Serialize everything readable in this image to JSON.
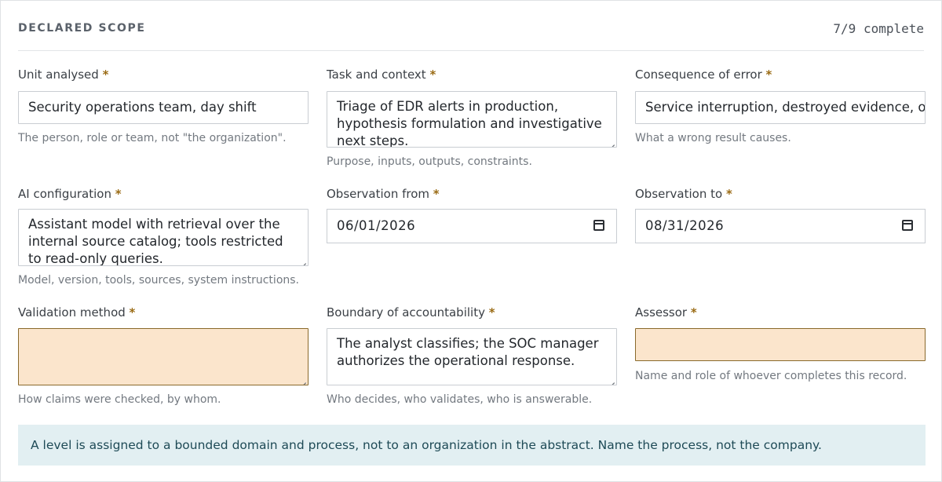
{
  "section": {
    "title": "DECLARED SCOPE",
    "progress": "7/9 complete"
  },
  "required_mark": "*",
  "fields": {
    "unit": {
      "label": "Unit analysed",
      "value": "Security operations team, day shift",
      "hint": "The person, role or team, not \"the organization\"."
    },
    "task": {
      "label": "Task and context",
      "value": "Triage of EDR alerts in production, hypothesis formulation and investigative next steps.",
      "hint": "Purpose, inputs, outputs, constraints."
    },
    "consequence": {
      "label": "Consequence of error",
      "value": "Service interruption, destroyed evidence, or a",
      "hint": "What a wrong result causes."
    },
    "ai_config": {
      "label": "AI configuration",
      "value": "Assistant model with retrieval over the internal source catalog; tools restricted to read-only queries.",
      "hint": "Model, version, tools, sources, system instructions."
    },
    "obs_from": {
      "label": "Observation from",
      "value": "06/01/2026"
    },
    "obs_to": {
      "label": "Observation to",
      "value": "08/31/2026"
    },
    "validation": {
      "label": "Validation method",
      "value": "",
      "hint": "How claims were checked, by whom."
    },
    "boundary": {
      "label": "Boundary of accountability",
      "value": "The analyst classifies; the SOC manager authorizes the operational response.",
      "hint": "Who decides, who validates, who is answerable."
    },
    "assessor": {
      "label": "Assessor",
      "value": "",
      "hint": "Name and role of whoever completes this record."
    }
  },
  "note": "A level is assigned to a bounded domain and process, not to an organization in the abstract. Name the process, not the company.",
  "colors": {
    "missing_field_bg": "#fbe5cc",
    "required_mark": "#9a6b14",
    "note_bg": "#e2eff2"
  },
  "icons": {
    "date_picker": "calendar-icon",
    "resize": "resize-grip-icon"
  }
}
